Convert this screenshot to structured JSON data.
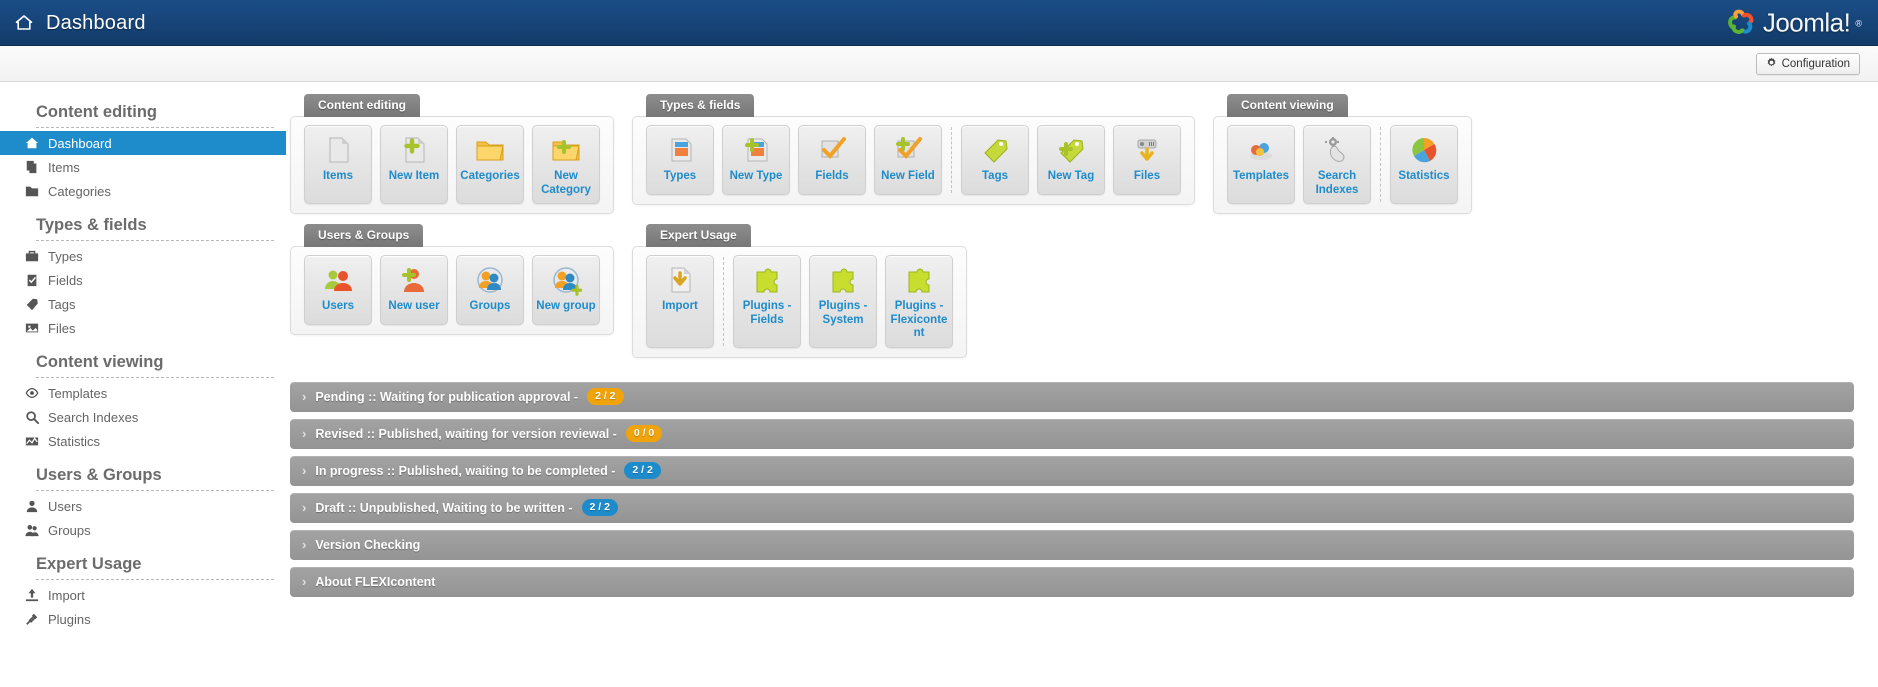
{
  "header": {
    "title": "Dashboard",
    "home_icon": "home-icon",
    "logo_text": "Joomla!",
    "logo_reg": "®"
  },
  "toolbar": {
    "configuration_label": "Configuration",
    "gear_icon": "gear-icon"
  },
  "sidebar": {
    "groups": [
      {
        "title": "Content editing",
        "items": [
          {
            "label": "Dashboard",
            "icon": "home-icon",
            "active": true
          },
          {
            "label": "Items",
            "icon": "copy-icon",
            "active": false
          },
          {
            "label": "Categories",
            "icon": "folder-icon",
            "active": false
          }
        ]
      },
      {
        "title": "Types & fields",
        "items": [
          {
            "label": "Types",
            "icon": "briefcase-icon",
            "active": false
          },
          {
            "label": "Fields",
            "icon": "clipboard-check-icon",
            "active": false
          },
          {
            "label": "Tags",
            "icon": "tag-icon",
            "active": false
          },
          {
            "label": "Files",
            "icon": "image-icon",
            "active": false
          }
        ]
      },
      {
        "title": "Content viewing",
        "items": [
          {
            "label": "Templates",
            "icon": "eye-icon",
            "active": false
          },
          {
            "label": "Search Indexes",
            "icon": "search-icon",
            "active": false
          },
          {
            "label": "Statistics",
            "icon": "chart-icon",
            "active": false
          }
        ]
      },
      {
        "title": "Users & Groups",
        "items": [
          {
            "label": "Users",
            "icon": "user-icon",
            "active": false
          },
          {
            "label": "Groups",
            "icon": "users-icon",
            "active": false
          }
        ]
      },
      {
        "title": "Expert Usage",
        "items": [
          {
            "label": "Import",
            "icon": "upload-icon",
            "active": false
          },
          {
            "label": "Plugins",
            "icon": "plug-icon",
            "active": false
          }
        ]
      }
    ]
  },
  "panels_row1": [
    {
      "tab": "Content editing",
      "tiles": [
        {
          "label": "Items",
          "icon": "document-icon",
          "sep_before": false
        },
        {
          "label": "New Item",
          "icon": "document-plus-icon",
          "sep_before": false
        },
        {
          "label": "Categories",
          "icon": "folder-icon",
          "sep_before": false
        },
        {
          "label": "New Category",
          "icon": "folder-plus-icon",
          "sep_before": false
        }
      ]
    },
    {
      "tab": "Types & fields",
      "tiles": [
        {
          "label": "Types",
          "icon": "type-icon",
          "sep_before": false
        },
        {
          "label": "New Type",
          "icon": "type-plus-icon",
          "sep_before": false
        },
        {
          "label": "Fields",
          "icon": "check-field-icon",
          "sep_before": false
        },
        {
          "label": "New Field",
          "icon": "check-field-plus-icon",
          "sep_before": false
        },
        {
          "label": "Tags",
          "icon": "tag-icon",
          "sep_before": true
        },
        {
          "label": "New Tag",
          "icon": "tag-plus-icon",
          "sep_before": false
        },
        {
          "label": "Files",
          "icon": "file-download-icon",
          "sep_before": false
        }
      ]
    },
    {
      "tab": "Content viewing",
      "tiles": [
        {
          "label": "Templates",
          "icon": "templates-icon",
          "sep_before": false
        },
        {
          "label": "Search Indexes",
          "icon": "search-gear-icon",
          "sep_before": false
        },
        {
          "label": "Statistics",
          "icon": "pie-chart-icon",
          "sep_before": true
        }
      ]
    }
  ],
  "panels_row2": [
    {
      "tab": "Users & Groups",
      "tiles": [
        {
          "label": "Users",
          "icon": "users-icon",
          "sep_before": false
        },
        {
          "label": "New user",
          "icon": "user-plus-icon",
          "sep_before": false
        },
        {
          "label": "Groups",
          "icon": "group-icon",
          "sep_before": false
        },
        {
          "label": "New group",
          "icon": "group-plus-icon",
          "sep_before": false
        }
      ]
    },
    {
      "tab": "Expert Usage",
      "tiles": [
        {
          "label": "Import",
          "icon": "import-icon",
          "sep_before": false
        },
        {
          "label": "Plugins - Fields",
          "icon": "puzzle-icon",
          "sep_before": true
        },
        {
          "label": "Plugins - System",
          "icon": "puzzle-icon",
          "sep_before": false
        },
        {
          "label": "Plugins - Flexicontent",
          "icon": "puzzle-icon",
          "sep_before": false
        }
      ]
    }
  ],
  "accordions": [
    {
      "title": "Pending :: Waiting for publication approval -",
      "badge": "2 / 2",
      "badge_color": "#f0a30a"
    },
    {
      "title": "Revised :: Published, waiting for version reviewal -",
      "badge": "0 / 0",
      "badge_color": "#f0a30a"
    },
    {
      "title": "In progress :: Published, waiting to be completed -",
      "badge": "2 / 2",
      "badge_color": "#1e8ccb"
    },
    {
      "title": "Draft :: Unpublished, Waiting to be written -",
      "badge": "2 / 2",
      "badge_color": "#1e8ccb"
    },
    {
      "title": "Version Checking",
      "badge": "",
      "badge_color": ""
    },
    {
      "title": "About FLEXIcontent",
      "badge": "",
      "badge_color": ""
    }
  ],
  "colors": {
    "header_blue": "#17457a",
    "accent_blue": "#1e8ccb",
    "badge_orange": "#f0a30a",
    "accordion_gray": "#9a9a9a",
    "tab_gray": "#7f7f7f"
  }
}
